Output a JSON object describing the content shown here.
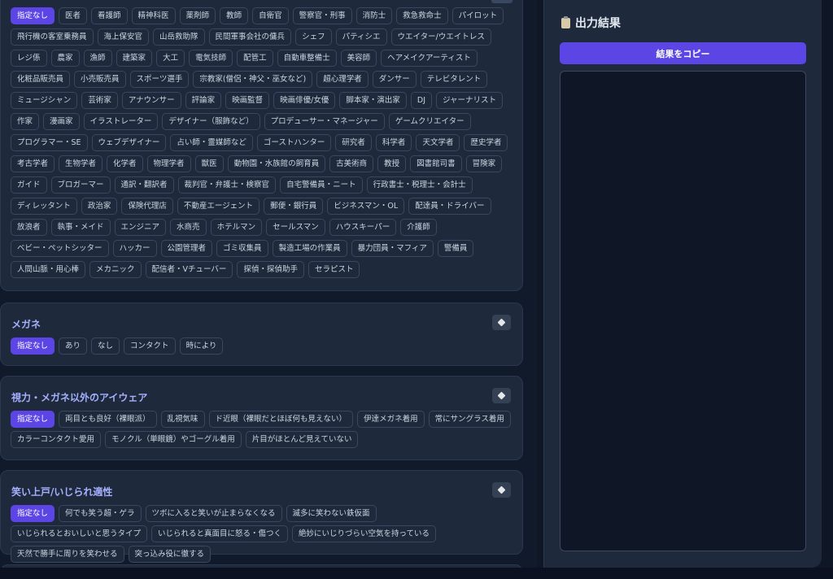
{
  "occupation": {
    "options": [
      {
        "label": "指定なし",
        "selected": true
      },
      {
        "label": "医者"
      },
      {
        "label": "看護師"
      },
      {
        "label": "精神科医"
      },
      {
        "label": "薬剤師"
      },
      {
        "label": "教師"
      },
      {
        "label": "自衛官"
      },
      {
        "label": "警察官・刑事"
      },
      {
        "label": "消防士"
      },
      {
        "label": "救急救命士"
      },
      {
        "label": "パイロット"
      },
      {
        "label": "飛行機の客室乗務員"
      },
      {
        "label": "海上保安官"
      },
      {
        "label": "山岳救助隊"
      },
      {
        "label": "民間軍事会社の傭兵"
      },
      {
        "label": "シェフ"
      },
      {
        "label": "パティシエ"
      },
      {
        "label": "ウエイター/ウエイトレス"
      },
      {
        "label": "レジ係"
      },
      {
        "label": "農家"
      },
      {
        "label": "漁師"
      },
      {
        "label": "建築家"
      },
      {
        "label": "大工"
      },
      {
        "label": "電気技師"
      },
      {
        "label": "配管工"
      },
      {
        "label": "自動車整備士"
      },
      {
        "label": "美容師"
      },
      {
        "label": "ヘアメイクアーティスト"
      },
      {
        "label": "化粧品販売員"
      },
      {
        "label": "小売販売員"
      },
      {
        "label": "スポーツ選手"
      },
      {
        "label": "宗教家(僧侶・神父・巫女など)"
      },
      {
        "label": "超心理学者"
      },
      {
        "label": "ダンサー"
      },
      {
        "label": "テレビタレント"
      },
      {
        "label": "ミュージシャン"
      },
      {
        "label": "芸術家"
      },
      {
        "label": "アナウンサー"
      },
      {
        "label": "評論家"
      },
      {
        "label": "映画監督"
      },
      {
        "label": "映画俳優/女優"
      },
      {
        "label": "脚本家・演出家"
      },
      {
        "label": "DJ"
      },
      {
        "label": "ジャーナリスト"
      },
      {
        "label": "作家"
      },
      {
        "label": "漫画家"
      },
      {
        "label": "イラストレーター"
      },
      {
        "label": "デザイナー（服飾など）"
      },
      {
        "label": "プロデューサー・マネージャー"
      },
      {
        "label": "ゲームクリエイター"
      },
      {
        "label": "プログラマー・SE"
      },
      {
        "label": "ウェブデザイナー"
      },
      {
        "label": "占い師・霊媒師など"
      },
      {
        "label": "ゴーストハンター"
      },
      {
        "label": "研究者"
      },
      {
        "label": "科学者"
      },
      {
        "label": "天文学者"
      },
      {
        "label": "歴史学者"
      },
      {
        "label": "考古学者"
      },
      {
        "label": "生物学者"
      },
      {
        "label": "化学者"
      },
      {
        "label": "物理学者"
      },
      {
        "label": "獣医"
      },
      {
        "label": "動物園・水族館の飼育員"
      },
      {
        "label": "古美術商"
      },
      {
        "label": "教授"
      },
      {
        "label": "図書館司書"
      },
      {
        "label": "冒険家"
      },
      {
        "label": "ガイド"
      },
      {
        "label": "ブロガーマー"
      },
      {
        "label": "通訳・翻訳者"
      },
      {
        "label": "裁判官・弁護士・検察官"
      },
      {
        "label": "自宅警備員・ニート"
      },
      {
        "label": "行政書士・税理士・会計士"
      },
      {
        "label": "ディレッタント"
      },
      {
        "label": "政治家"
      },
      {
        "label": "保険代理店"
      },
      {
        "label": "不動産エージェント"
      },
      {
        "label": "郵便・銀行員"
      },
      {
        "label": "ビジネスマン・OL"
      },
      {
        "label": "配達員・ドライバー"
      },
      {
        "label": "放浪者"
      },
      {
        "label": "執事・メイド"
      },
      {
        "label": "エンジニア"
      },
      {
        "label": "水商売"
      },
      {
        "label": "ホテルマン"
      },
      {
        "label": "セールスマン"
      },
      {
        "label": "ハウスキーパー"
      },
      {
        "label": "介護師"
      },
      {
        "label": "ベビー・ペットシッター"
      },
      {
        "label": "ハッカー"
      },
      {
        "label": "公園管理者"
      },
      {
        "label": "ゴミ収集員"
      },
      {
        "label": "製造工場の作業員"
      },
      {
        "label": "暴力団員・マフィア"
      },
      {
        "label": "警備員"
      },
      {
        "label": "人間山脈・用心棒"
      },
      {
        "label": "メカニック"
      },
      {
        "label": "配信者・Vチューバー"
      },
      {
        "label": "探偵・探偵助手"
      },
      {
        "label": "セラピスト"
      }
    ]
  },
  "glasses": {
    "title": "メガネ",
    "options": [
      {
        "label": "指定なし",
        "selected": true
      },
      {
        "label": "あり"
      },
      {
        "label": "なし"
      },
      {
        "label": "コンタクト"
      },
      {
        "label": "時により"
      }
    ]
  },
  "eyewear": {
    "title": "視力・メガネ以外のアイウェア",
    "options": [
      {
        "label": "指定なし",
        "selected": true
      },
      {
        "label": "両目とも良好（裸眼派）"
      },
      {
        "label": "乱視気味"
      },
      {
        "label": "ド近眼（裸眼だとほぼ何も見えない）"
      },
      {
        "label": "伊達メガネ着用"
      },
      {
        "label": "常にサングラス着用"
      },
      {
        "label": "カラーコンタクト愛用"
      },
      {
        "label": "モノクル（単眼鏡）やゴーグル着用"
      },
      {
        "label": "片目がほとんど見えていない"
      }
    ]
  },
  "laugh": {
    "title": "笑い上戸/いじられ適性",
    "options": [
      {
        "label": "指定なし",
        "selected": true
      },
      {
        "label": "何でも笑う超・ゲラ"
      },
      {
        "label": "ツボに入ると笑いが止まらなくなる"
      },
      {
        "label": "滅多に笑わない鉄仮面"
      },
      {
        "label": "いじられるとおいしいと思うタイプ"
      },
      {
        "label": "いじられると真面目に怒る・傷つく"
      },
      {
        "label": "絶妙にいじりづらい空気を持っている"
      },
      {
        "label": "天然で勝手に周りを笑わせる"
      },
      {
        "label": "突っ込み役に徹する"
      }
    ]
  },
  "output": {
    "title": "出力結果",
    "copy_label": "結果をコピー",
    "result": ""
  },
  "colors": {
    "accent": "#5b46e5",
    "panel": "#1e293b",
    "background": "#0f1726",
    "title_accent": "#a5b0ff"
  }
}
